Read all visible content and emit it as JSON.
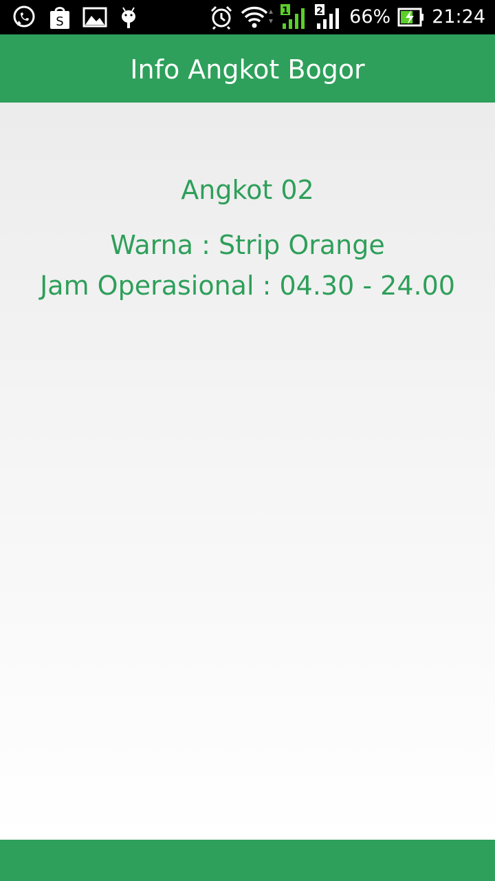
{
  "status_bar": {
    "left_icons": [
      "whatsapp-icon",
      "shop-bag-icon",
      "gallery-icon",
      "android-icon"
    ],
    "right_icons": [
      "alarm-icon",
      "wifi-icon",
      "signal-sim1-icon",
      "signal-sim2-icon",
      "battery-charging-icon"
    ],
    "sim1_label": "1",
    "sim2_label": "2",
    "battery_percent": "66%",
    "battery_level": 0.66,
    "time": "21:24",
    "colors": {
      "background": "#000000",
      "foreground": "#ffffff",
      "accent": "#5ccf2a"
    }
  },
  "app_bar": {
    "title": "Info Angkot Bogor",
    "color": "#2ea05b"
  },
  "content": {
    "angkot_name": "Angkot 02",
    "warna": "Warna : Strip Orange",
    "jam_operasional": "Jam Operasional : 04.30 - 24.00",
    "text_color": "#2e9f5a"
  },
  "bottom_bar": {
    "color": "#2ea05b"
  }
}
